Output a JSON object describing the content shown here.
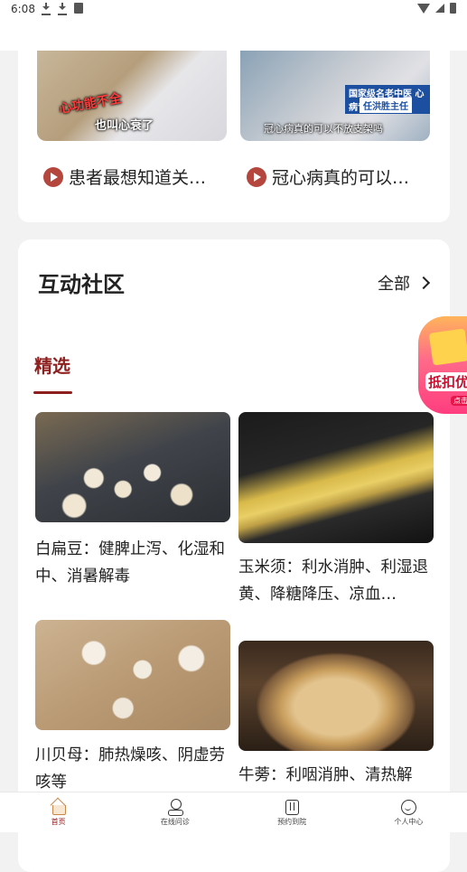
{
  "status_bar": {
    "time": "6:08"
  },
  "videos": [
    {
      "thumb_caption_1": "心功能不全",
      "thumb_caption_2": "也叫心衰了",
      "title": "患者最想知道关…"
    },
    {
      "thumb_caption_1": "国家级名老中医 心病专科",
      "thumb_caption_2": "任洪胜主任",
      "thumb_caption_3": "冠心病真的可以不放支架吗",
      "title": "冠心病真的可以…"
    }
  ],
  "community": {
    "title": "互动社区",
    "all_label": "全部",
    "tab_featured": "精选",
    "posts": [
      {
        "text": "白扁豆：健脾止泻、化湿和中、消暑解毒"
      },
      {
        "text": "玉米须：利水消肿、利湿退黄、降糖降压、凉血…"
      },
      {
        "text": "川贝母：肺热燥咳、阴虚劳咳等"
      },
      {
        "text": "牛蒡：利咽消肿、清热解"
      }
    ]
  },
  "promo": {
    "text": "抵扣优",
    "sub": "点击"
  },
  "bottom_nav": [
    {
      "label": "首页"
    },
    {
      "label": "在线问诊"
    },
    {
      "label": "预约到院"
    },
    {
      "label": "个人中心"
    }
  ],
  "colors": {
    "accent": "#8e1f1f",
    "play": "#b4463d"
  }
}
